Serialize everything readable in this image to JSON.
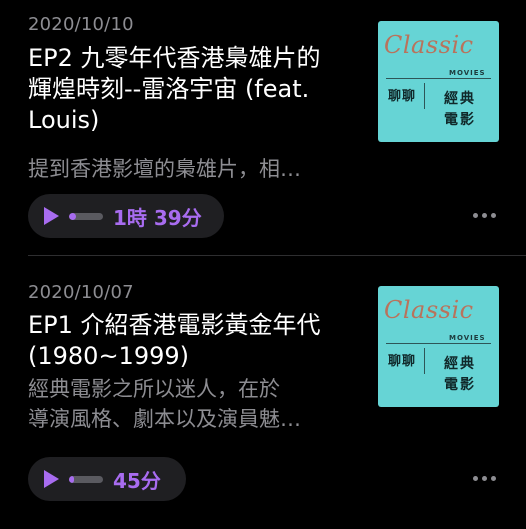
{
  "episodes": [
    {
      "date": "2020/10/10",
      "title_line1": "EP2 九零年代香港梟雄片的",
      "title_line2": "輝煌時刻--雷洛宇宙 (feat.",
      "title_line3": "Louis)",
      "desc_line1": "提到香港影壇的梟雄片，相…",
      "duration": "1時 39分",
      "artwork": {
        "classic": "Classic",
        "movies": "MOVIES",
        "chat": "聊聊",
        "cn1": "經典",
        "cn2": "電影"
      }
    },
    {
      "date": "2020/10/07",
      "title_line1": "EP1 介紹香港電影黃金年代",
      "title_line2": "(1980~1999)",
      "desc_line1": "經典電影之所以迷人，在於",
      "desc_line2": "導演風格、劇本以及演員魅…",
      "duration": "45分",
      "artwork": {
        "classic": "Classic",
        "movies": "MOVIES",
        "chat": "聊聊",
        "cn1": "經典",
        "cn2": "電影"
      }
    }
  ],
  "colors": {
    "background": "#000000",
    "accent": "#a86cf0",
    "secondary_text": "#8d8d92",
    "artwork_bg": "#66d4d5",
    "artwork_script": "#b9735c"
  },
  "icons": {
    "play": "play-icon",
    "more": "more-icon"
  }
}
